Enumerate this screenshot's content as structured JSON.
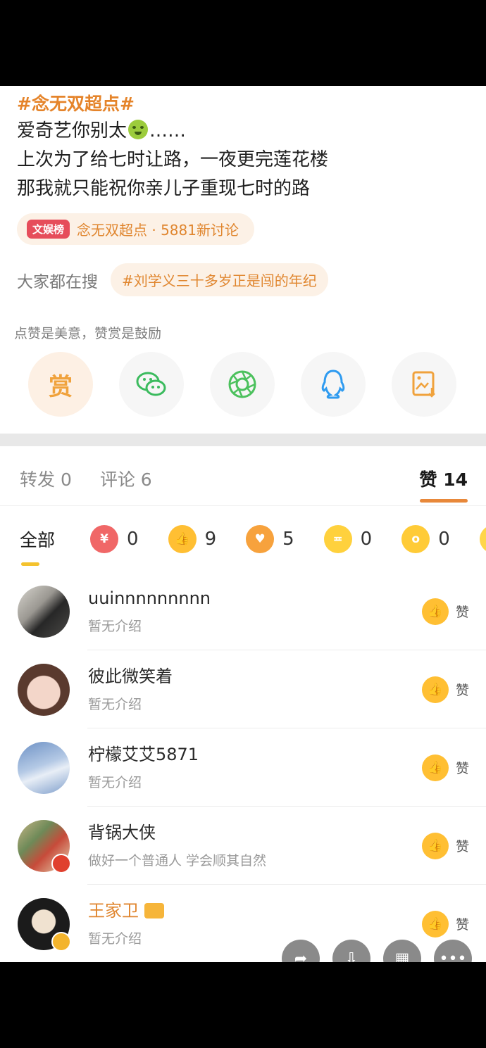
{
  "post": {
    "hashtag": "#念无双超点#",
    "line1_prefix": "爱奇艺你别太",
    "line1_suffix": "……",
    "line2": "上次为了给七时让路，一夜更完莲花楼",
    "line3": "那我就只能祝你亲儿子重现七时的路",
    "topic_badge": "文娱榜",
    "topic_text": "念无双超点 · 5881新讨论",
    "search_label": "大家都在搜",
    "search_topic": "#刘学义三十多岁正是闯的年纪",
    "encourage": "点赞是美意，赞赏是鼓励",
    "reward_label": "赏"
  },
  "tabs": {
    "repost": "转发 0",
    "comment": "评论 6",
    "like": "赞 14"
  },
  "filters": {
    "all": "全部",
    "counts": [
      "0",
      "9",
      "5",
      "0",
      "0"
    ]
  },
  "users": [
    {
      "name": "uuinnnnnnnnn",
      "desc": "暂无介绍"
    },
    {
      "name": "彼此微笑着",
      "desc": "暂无介绍"
    },
    {
      "name": "柠檬艾艾5871",
      "desc": "暂无介绍"
    },
    {
      "name": "背锅大侠",
      "desc": "做好一个普通人 学会顺其自然"
    },
    {
      "name": "王家卫",
      "desc": "暂无介绍"
    }
  ],
  "like_label": "赞",
  "colors": {
    "accent": "#e0862f",
    "tab_indicator": "#e8883a",
    "filter_indicator": "#f4c22e"
  }
}
